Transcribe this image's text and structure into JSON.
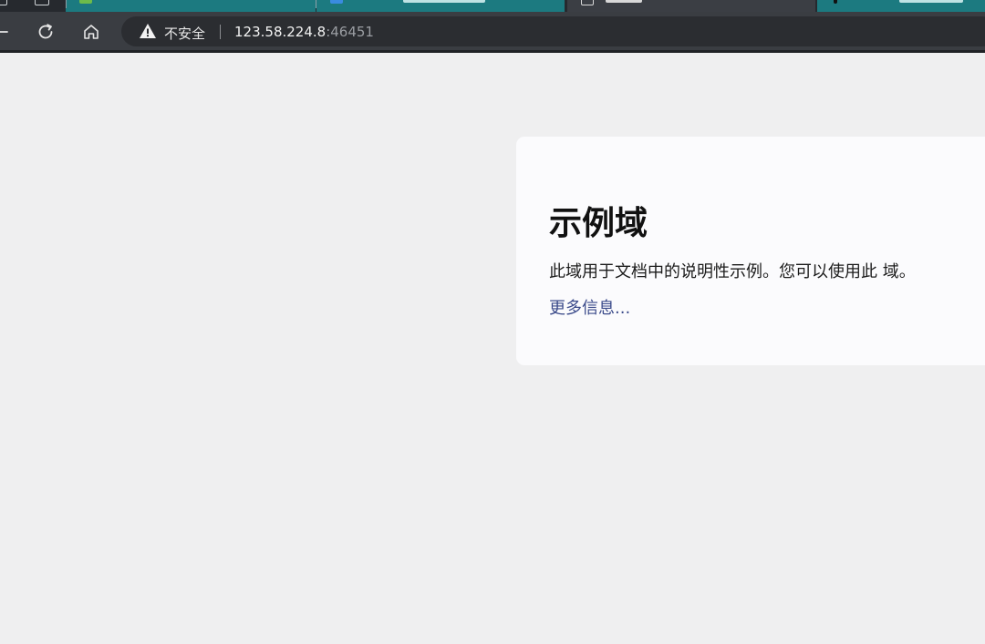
{
  "browser": {
    "security_label": "不安全",
    "url_host": "123.58.224.8",
    "url_port": ":46451"
  },
  "page": {
    "heading": "示例域",
    "description": "此域用于文档中的说明性示例。您可以使用此 域。",
    "link_text": "更多信息..."
  },
  "colors": {
    "page_background": "#efeff0",
    "card_background": "#fbfbfd",
    "link": "#3a4a8a",
    "tab_accent": "#1c7a80",
    "toolbar": "#3a3d42"
  }
}
